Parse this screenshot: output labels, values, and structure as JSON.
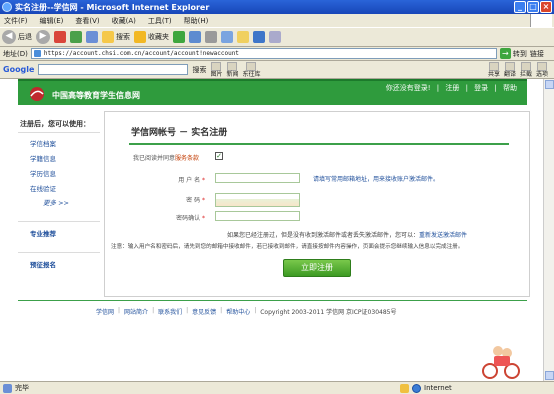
{
  "window": {
    "title": "实名注册--学信网 - Microsoft Internet Explorer"
  },
  "menu": [
    "文件(F)",
    "编辑(E)",
    "查看(V)",
    "收藏(A)",
    "工具(T)",
    "帮助(H)"
  ],
  "toolbar": {
    "back": "后退",
    "search": "搜索",
    "favorites": "收藏夹"
  },
  "address": {
    "label": "地址(D)",
    "url": "https://account.chsi.com.cn/account/account!newaccount",
    "go": "转到",
    "links": "链接"
  },
  "google": {
    "logo": "Google",
    "search_btn": "搜索",
    "tools": [
      "图片",
      "新闻",
      "东往库"
    ],
    "right_tools": [
      "共享",
      "翻译",
      "拦截",
      "选项"
    ]
  },
  "site": {
    "name": "中国高等教育学生信息网",
    "top_links": [
      "你还没有登录!",
      "注册",
      "登录",
      "帮助"
    ]
  },
  "sidebar": {
    "title": "注册后，您可以使用：",
    "items": [
      "学信档案",
      "学籍信息",
      "学历信息",
      "在线验证"
    ],
    "more": "更多 >>",
    "sections": [
      "专业推荐",
      "预征报名"
    ]
  },
  "form": {
    "title": "学信网帐号 － 实名注册",
    "agree_prefix": "我已阅读并同意",
    "agree_link": "服务条款",
    "checkbox_mark": "✓",
    "username_label": "用 户 名",
    "password_label": "密    码",
    "confirm_label": "密码确认",
    "required": "*",
    "username_hint": "请填写常用邮箱地址，用来接收账户激活邮件。",
    "resend_text": "如果您已经注册过，但是没有收到激活邮件或者丢失激活邮件，您可以：",
    "resend_link": "重新发送激活邮件",
    "note": "注意：输入用户名和密码后，请先到您的邮箱中接收邮件，若已接收到邮件，请直接按邮件内容操作，页面会提示您继续输入信息以完成注册。",
    "submit": "立即注册"
  },
  "footer": {
    "links": [
      "学信网",
      "网站简介",
      "联系我们",
      "意见反馈",
      "帮助中心"
    ],
    "copyright": "Copyright 2003-2011 学信网 京ICP证030485号"
  },
  "status": {
    "left": "完毕",
    "zone": "Internet"
  }
}
